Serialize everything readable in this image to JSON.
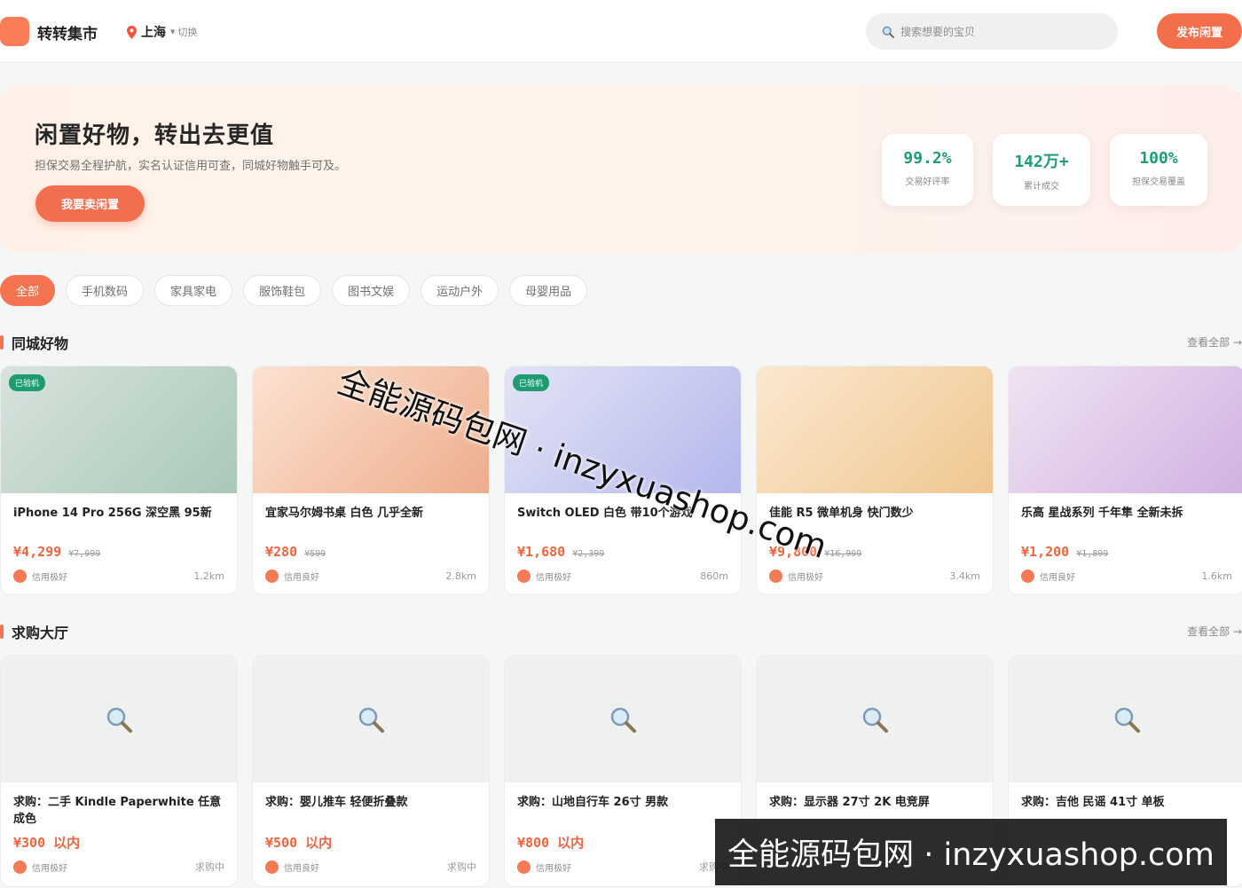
{
  "header": {
    "brand": "转转集市",
    "city": "上海",
    "switch_label": "切换",
    "search_placeholder": "搜索想要的宝贝",
    "publish_label": "发布闲置"
  },
  "hero": {
    "title": "闲置好物，转出去更值",
    "subtitle": "担保交易全程护航，实名认证信用可查，同城好物触手可及。",
    "button": "我要卖闲置",
    "stats": [
      {
        "value": "99.2%",
        "label": "交易好评率"
      },
      {
        "value": "142万+",
        "label": "累计成交"
      },
      {
        "value": "100%",
        "label": "担保交易覆盖"
      }
    ]
  },
  "categories": [
    "全部",
    "手机数码",
    "家具家电",
    "服饰鞋包",
    "图书文娱",
    "运动户外",
    "母婴用品"
  ],
  "local": {
    "title": "同城好物",
    "more": "查看全部 →",
    "items": [
      {
        "badge": "已验机",
        "title": "iPhone 14 Pro 256G 深空黑 95新",
        "price": "¥4,299",
        "orig": "¥7,999",
        "seller": "信用极好",
        "dist": "1.2km",
        "color_a": "#d7e3dc",
        "color_b": "#a9c8b7"
      },
      {
        "badge": "",
        "title": "宜家马尔姆书桌 白色 几乎全新",
        "price": "¥280",
        "orig": "¥599",
        "seller": "信用良好",
        "dist": "2.8km",
        "color_a": "#fde2d2",
        "color_b": "#edad8b"
      },
      {
        "badge": "已验机",
        "title": "Switch OLED 白色 带10个游戏",
        "price": "¥1,680",
        "orig": "¥2,399",
        "seller": "信用极好",
        "dist": "860m",
        "color_a": "#e3e4f5",
        "color_b": "#b3b7ec"
      },
      {
        "badge": "",
        "title": "佳能 R5 微单机身 快门数少",
        "price": "¥9,800",
        "orig": "¥16,999",
        "seller": "信用极好",
        "dist": "3.4km",
        "color_a": "#fbe8cf",
        "color_b": "#efc690"
      },
      {
        "badge": "",
        "title": "乐高 星战系列 千年隼 全新未拆",
        "price": "¥1,200",
        "orig": "¥1,899",
        "seller": "信用良好",
        "dist": "1.6km",
        "color_a": "#f0e3f2",
        "color_b": "#d0b2e1"
      }
    ]
  },
  "wanted": {
    "title": "求购大厅",
    "more": "查看全部 →",
    "items": [
      {
        "title": "求购：二手 Kindle Paperwhite 任意成色",
        "price": "¥300 以内",
        "seller": "信用极好",
        "status": "求购中"
      },
      {
        "title": "求购：婴儿推车 轻便折叠款",
        "price": "¥500 以内",
        "seller": "信用良好",
        "status": "求购中"
      },
      {
        "title": "求购：山地自行车 26寸 男款",
        "price": "¥800 以内",
        "seller": "信用极好",
        "status": "求购中"
      },
      {
        "title": "求购：显示器 27寸 2K 电竞屏",
        "price": "",
        "seller": "",
        "status": ""
      },
      {
        "title": "求购：吉他 民谣 41寸 单板",
        "price": "",
        "seller": "",
        "status": ""
      }
    ]
  },
  "watermarks": {
    "diagonal": "全能源码包网 · inzyxuashop.com",
    "bar": "全能源码包网 · inzyxuashop.com"
  }
}
